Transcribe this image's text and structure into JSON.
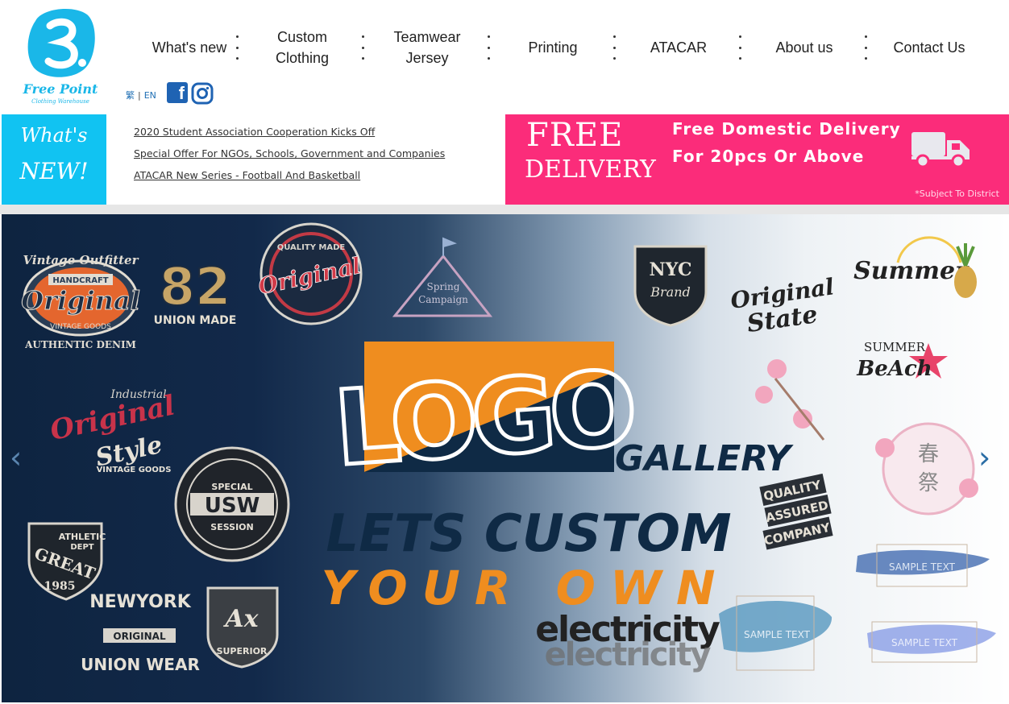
{
  "brand": {
    "logo_text": "Free Point",
    "logo_subtext": "Clothing Warehouse"
  },
  "nav": {
    "items": [
      "What's new",
      "Custom\nClothing",
      "Teamwear\nJersey",
      "Printing",
      "ATACAR",
      "About us",
      "Contact Us"
    ]
  },
  "language": {
    "zh": "繁",
    "separator": "|",
    "en": "EN"
  },
  "social": {
    "facebook": "facebook-icon",
    "instagram": "instagram-icon"
  },
  "news": {
    "badge_line1": "What's",
    "badge_line2": "NEW!",
    "links": [
      "2020 Student Association Cooperation Kicks Off",
      "Special Offer For NGOs, Schools, Government and Companies",
      "ATACAR New Series - Football And Basketball"
    ]
  },
  "delivery": {
    "free": "FREE",
    "delivery": "DELIVERY",
    "line1": "Free Domestic Delivery",
    "line2": "For 20pcs Or Above",
    "note": "*Subject To District",
    "icon": "truck-icon",
    "color": "#fb2c7a"
  },
  "banner": {
    "headline": "LOGO",
    "headline_sub": "GALLERY",
    "line1": "LETS CUSTOM",
    "line2": "YOUR OWN",
    "electricity": "electricity",
    "badges": {
      "vintage_top": "Vintage Outfitter",
      "vintage_ribbon": "HANDCRAFT",
      "original": "Original",
      "vintage_goods": "VINTAGE GOODS",
      "authentic_denim": "AUTHENTIC DENIM",
      "number": "82",
      "union_made": "UNION MADE",
      "quality_made": "QUALITY MADE",
      "spring": "Spring",
      "campaign": "Campaign",
      "nyc": "NYC",
      "brand": "Brand",
      "original_state_1": "Original",
      "original_state_2": "State",
      "summer": "Summer",
      "summer_beach_1": "SUMMER",
      "summer_beach_2": "BeAch",
      "industrial": "Industrial",
      "style": "Style",
      "usw_special": "SPECIAL",
      "usw": "USW",
      "usw_session": "SESSION",
      "athletic": "ATHLETIC",
      "dept": "DEPT",
      "great": "GREAT",
      "year": "1985",
      "newyork": "NEWYORK",
      "original_small": "ORIGINAL",
      "union_wear": "UNION WEAR",
      "ax": "Ax",
      "superior": "SUPERIOR",
      "quality": "QUALITY",
      "assured": "ASSURED",
      "company": "COMPANY",
      "sample_text_1": "SAMPLE TEXT",
      "sample_text_2": "SAMPLE TEXT",
      "sample_text_3": "SAMPLE TEXT",
      "haru": "春",
      "matsuri": "祭"
    },
    "prev": "‹",
    "next": "›"
  }
}
